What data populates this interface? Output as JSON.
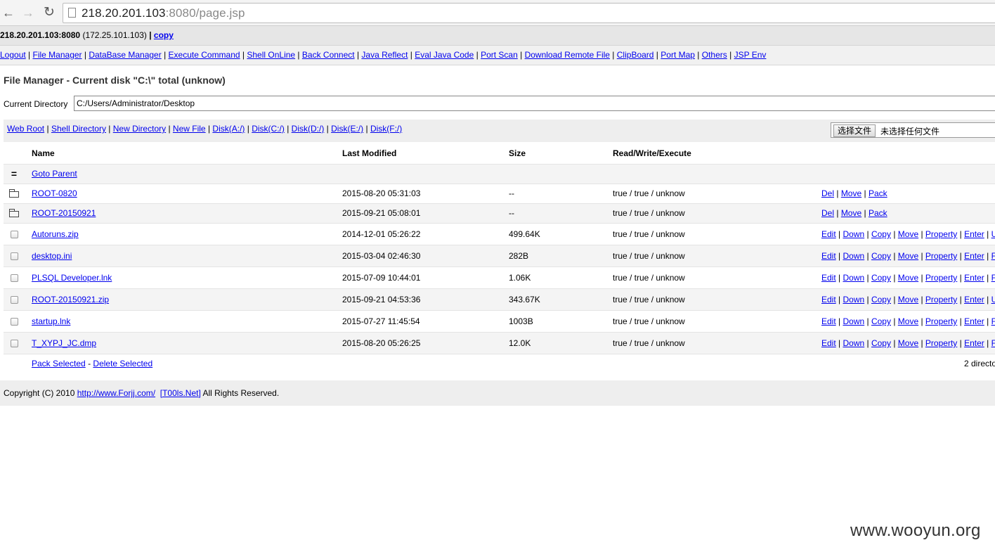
{
  "browser": {
    "url_host": "218.20.201.103",
    "url_rest": ":8080/page.jsp",
    "back": "←",
    "forward": "→",
    "reload": "↻"
  },
  "hostbar": {
    "host": "218.20.201.103:8080",
    "ip": "(172.25.101.103)",
    "sep": "|",
    "copy": "copy"
  },
  "menu": [
    "Logout",
    "File Manager",
    "DataBase Manager",
    "Execute Command",
    "Shell OnLine",
    "Back Connect",
    "Java Reflect",
    "Eval Java Code",
    "Port Scan",
    "Download Remote File",
    "ClipBoard",
    "Port Map",
    "Others",
    "JSP Env"
  ],
  "title": "File Manager - Current disk \"C:\\\" total (unknow)",
  "current_directory": {
    "label": "Current Directory",
    "value": "C:/Users/Administrator/Desktop"
  },
  "toolbar_links": [
    "Web Root",
    "Shell Directory",
    "New Directory",
    "New File",
    "Disk(A:/)",
    "Disk(C:/)",
    "Disk(D:/)",
    "Disk(E:/)",
    "Disk(F:/)"
  ],
  "upload": {
    "button": "选择文件",
    "status": "未选择任何文件"
  },
  "table": {
    "headers": {
      "name": "Name",
      "modified": "Last Modified",
      "size": "Size",
      "rwx": "Read/Write/Execute"
    },
    "parent": {
      "icon": "=",
      "label": "Goto Parent"
    },
    "rows": [
      {
        "icon": "folder-icon",
        "name": "ROOT-0820",
        "modified": "2015-08-20 05:31:03",
        "size": "--",
        "rwx": "true / true / unknow",
        "actions": [
          "Del",
          "Move",
          "Pack"
        ]
      },
      {
        "icon": "folder-icon",
        "name": "ROOT-20150921",
        "modified": "2015-09-21 05:08:01",
        "size": "--",
        "rwx": "true / true / unknow",
        "actions": [
          "Del",
          "Move",
          "Pack"
        ]
      },
      {
        "icon": "checkbox",
        "name": "Autoruns.zip",
        "modified": "2014-12-01 05:26:22",
        "size": "499.64K",
        "rwx": "true / true / unknow",
        "actions": [
          "Edit",
          "Down",
          "Copy",
          "Move",
          "Property",
          "Enter",
          "U"
        ]
      },
      {
        "icon": "checkbox",
        "name": "desktop.ini",
        "modified": "2015-03-04 02:46:30",
        "size": "282B",
        "rwx": "true / true / unknow",
        "actions": [
          "Edit",
          "Down",
          "Copy",
          "Move",
          "Property",
          "Enter",
          "F"
        ]
      },
      {
        "icon": "checkbox",
        "name": "PLSQL Developer.lnk",
        "modified": "2015-07-09 10:44:01",
        "size": "1.06K",
        "rwx": "true / true / unknow",
        "actions": [
          "Edit",
          "Down",
          "Copy",
          "Move",
          "Property",
          "Enter",
          "F"
        ]
      },
      {
        "icon": "checkbox",
        "name": "ROOT-20150921.zip",
        "modified": "2015-09-21 04:53:36",
        "size": "343.67K",
        "rwx": "true / true / unknow",
        "actions": [
          "Edit",
          "Down",
          "Copy",
          "Move",
          "Property",
          "Enter",
          "U"
        ]
      },
      {
        "icon": "checkbox",
        "name": "startup.lnk",
        "modified": "2015-07-27 11:45:54",
        "size": "1003B",
        "rwx": "true / true / unknow",
        "actions": [
          "Edit",
          "Down",
          "Copy",
          "Move",
          "Property",
          "Enter",
          "F"
        ]
      },
      {
        "icon": "checkbox",
        "name": "T_XYPJ_JC.dmp",
        "modified": "2015-08-20 05:26:25",
        "size": "12.0K",
        "rwx": "true / true / unknow",
        "actions": [
          "Edit",
          "Down",
          "Copy",
          "Move",
          "Property",
          "Enter",
          "F"
        ]
      }
    ],
    "footer": {
      "pack": "Pack Selected",
      "dash": "-",
      "delete": "Delete Selected",
      "summary": "2 directo"
    }
  },
  "copyright": {
    "prefix": "Copyright (C) 2010",
    "link1": "http://www.Forjj.com/",
    "link2": "[T00ls.Net]",
    "suffix": "All Rights Reserved."
  },
  "watermark": "www.wooyun.org"
}
